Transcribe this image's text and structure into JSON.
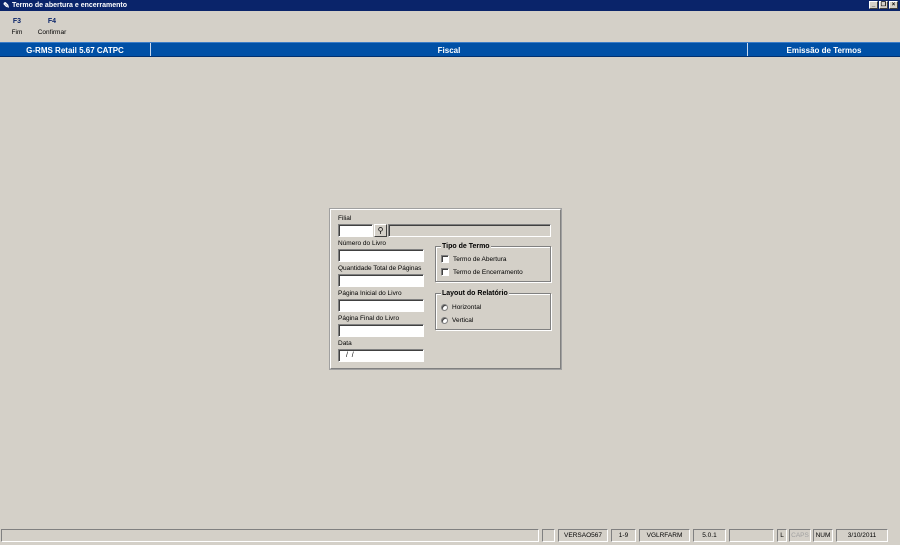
{
  "window": {
    "title": "Termo de abertura e encerramento",
    "controls": [
      "minimize",
      "restore",
      "close"
    ]
  },
  "toolbar": {
    "items": [
      {
        "key": "F3",
        "label": "Fim"
      },
      {
        "key": "F4",
        "label": "Confirmar"
      }
    ]
  },
  "header": {
    "system": "G-RMS Retail 5.67 CATPC",
    "module": "Fiscal",
    "screen": "Emissão de Termos"
  },
  "form": {
    "filial_label": "Filial",
    "filial_value": "",
    "filial_name": "",
    "numero_livro_label": "Número do Livro",
    "numero_livro_value": "",
    "qtd_paginas_label": "Quantidade Total de Páginas",
    "qtd_paginas_value": "",
    "pagina_inicial_label": "Página Inicial do Livro",
    "pagina_inicial_value": "",
    "pagina_final_label": "Página Final do Livro",
    "pagina_final_value": "",
    "data_label": "Data",
    "data_value": " /  /",
    "tipo_termo": {
      "legend": "Tipo de Termo",
      "options": [
        "Termo de Abertura",
        "Termo de Encerramento"
      ]
    },
    "layout": {
      "legend": "Layout do Relatório",
      "options": [
        "Horizontal",
        "Vertical"
      ]
    }
  },
  "status": {
    "cells": [
      "",
      "",
      "VERSAO567",
      "1-9",
      "VGLRFARM",
      "5.0.1",
      "",
      "L",
      "CAPS",
      "NUM",
      "3/10/2011"
    ]
  },
  "colors": {
    "titlebar": "#0a246a",
    "header_bar": "#0050a6",
    "background": "#d4d0c8"
  }
}
